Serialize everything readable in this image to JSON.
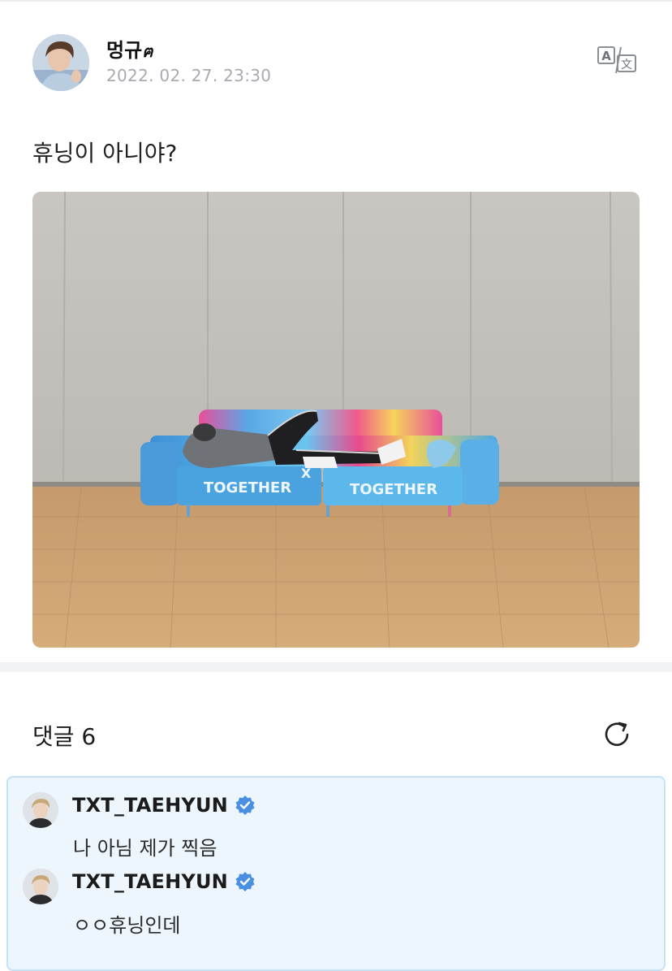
{
  "post": {
    "author_name": "멍규",
    "author_suffix": "ฅ",
    "date": "2022. 02. 27. 23:30",
    "translate_icon": "translate-icon",
    "text": "휴닝이 아니야?",
    "photo": {
      "description_icon": "photo-sofa-lying",
      "sofa_text_left": "TOGETHER",
      "sofa_text_right": "TOGETHER",
      "sofa_text_cross": "X"
    }
  },
  "comments": {
    "title": "댓글 6",
    "refresh_icon": "refresh-icon",
    "items": [
      {
        "name": "TXT_TAEHYUN",
        "verified": true,
        "text": "나 아님 제가 찍음"
      },
      {
        "name": "TXT_TAEHYUN",
        "verified": true,
        "text": "ㅇㅇ휴닝인데"
      }
    ]
  },
  "colors": {
    "accent_verified": "#4a90e2",
    "comment_bg": "#edf6fd",
    "comment_border": "#c6e2f7",
    "date_gray": "#a7abb1"
  }
}
